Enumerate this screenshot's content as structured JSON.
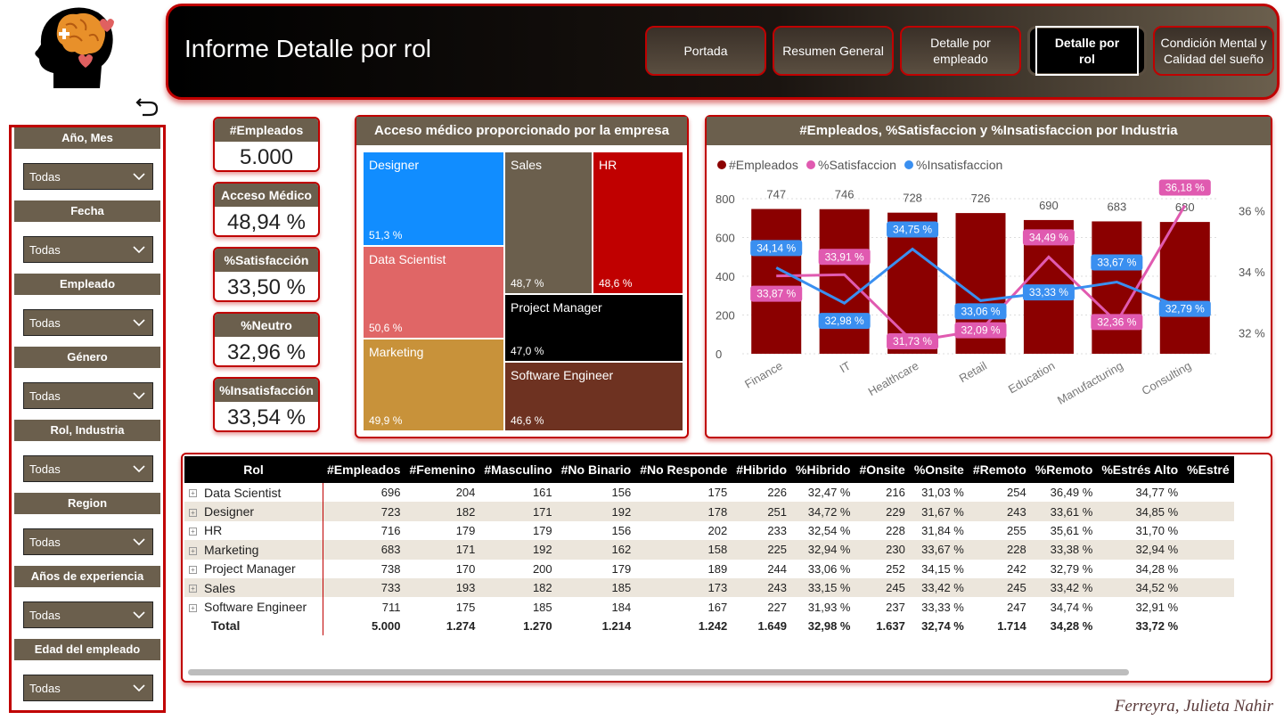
{
  "header": {
    "title": "Informe Detalle por rol",
    "nav": [
      {
        "label": "Portada",
        "active": false
      },
      {
        "label": "Resumen General",
        "active": false
      },
      {
        "label": "Detalle por empleado",
        "active": false
      },
      {
        "label": "Detalle por rol",
        "active": true
      },
      {
        "label": "Condición Mental y Calidad del sueño",
        "active": false
      }
    ]
  },
  "filters": [
    {
      "title": "Año, Mes",
      "value": "Todas"
    },
    {
      "title": "Fecha",
      "value": "Todas"
    },
    {
      "title": "Empleado",
      "value": "Todas"
    },
    {
      "title": "Género",
      "value": "Todas"
    },
    {
      "title": "Rol, Industria",
      "value": "Todas"
    },
    {
      "title": "Region",
      "value": "Todas"
    },
    {
      "title": "Años de experiencia",
      "value": "Todas"
    },
    {
      "title": "Edad del empleado",
      "value": "Todas"
    }
  ],
  "kpis": [
    {
      "title": "#Empleados",
      "value": "5.000"
    },
    {
      "title": "Acceso Médico",
      "value": "48,94 %"
    },
    {
      "title": "%Satisfacción",
      "value": "33,50 %"
    },
    {
      "title": "%Neutro",
      "value": "32,96 %"
    },
    {
      "title": "%Insatisfacción",
      "value": "33,54 %"
    }
  ],
  "colors": {
    "accent_red": "#c00000",
    "brown": "#6b5f4d",
    "bar": "#8b0000",
    "satisfaccion": "#e05ab0",
    "insatisfaccion": "#3a8ff0"
  },
  "chart_data": [
    {
      "type": "treemap",
      "title": "Acceso médico proporcionado por la empresa",
      "items": [
        {
          "label": "Designer",
          "value": "51,3 %",
          "color": "#118dff"
        },
        {
          "label": "Data Scientist",
          "value": "50,6 %",
          "color": "#e06666"
        },
        {
          "label": "Marketing",
          "value": "49,9 %",
          "color": "#c8923a"
        },
        {
          "label": "Sales",
          "value": "48,7 %",
          "color": "#6b5f4d"
        },
        {
          "label": "HR",
          "value": "48,6 %",
          "color": "#c00000"
        },
        {
          "label": "Project Manager",
          "value": "47,0 %",
          "color": "#000000"
        },
        {
          "label": "Software Engineer",
          "value": "46,6 %",
          "color": "#6e3221"
        }
      ]
    },
    {
      "type": "bar",
      "title": "#Empleados, %Satisfaccion y %Insatisfaccion por Industria",
      "categories": [
        "Finance",
        "IT",
        "Healthcare",
        "Retail",
        "Education",
        "Manufacturing",
        "Consulting"
      ],
      "series": [
        {
          "name": "#Empleados",
          "type": "bar",
          "axis": "left",
          "values": [
            747,
            746,
            728,
            726,
            690,
            683,
            680
          ],
          "labels": [
            "747",
            "746",
            "728",
            "726",
            "690",
            "683",
            "680"
          ]
        },
        {
          "name": "%Satisfaccion",
          "type": "line",
          "axis": "right",
          "values": [
            33.87,
            33.91,
            31.73,
            32.09,
            34.49,
            32.36,
            36.18
          ],
          "labels": [
            "33,87 %",
            "33,91 %",
            "31,73 %",
            "32,09 %",
            "34,49 %",
            "32,36 %",
            "36,18 %"
          ]
        },
        {
          "name": "%Insatisfaccion",
          "type": "line",
          "axis": "right",
          "values": [
            34.14,
            32.98,
            34.75,
            33.06,
            33.33,
            33.67,
            32.79
          ],
          "labels": [
            "34,14 %",
            "32,98 %",
            "34,75 %",
            "33,06 %",
            "33,33 %",
            "33,67 %",
            "32,79 %"
          ]
        }
      ],
      "ylim_left": [
        0,
        800
      ],
      "yticks_left": [
        "800",
        "600",
        "400",
        "200",
        "0"
      ],
      "ylim_right": [
        31,
        36.4
      ],
      "yticks_right": [
        {
          "v": 36,
          "label": "36 %"
        },
        {
          "v": 34,
          "label": "34 %"
        },
        {
          "v": 32,
          "label": "32 %"
        }
      ],
      "legend": "top-left",
      "grid": true
    }
  ],
  "table": {
    "headers": [
      "Rol",
      "#Empleados",
      "#Femenino",
      "#Masculino",
      "#No Binario",
      "#No Responde",
      "#Hibrido",
      "%Hibrido",
      "#Onsite",
      "%Onsite",
      "#Remoto",
      "%Remoto",
      "%Estrés Alto",
      "%Estré"
    ],
    "rows": [
      [
        "Data Scientist",
        "696",
        "204",
        "161",
        "156",
        "175",
        "226",
        "32,47 %",
        "216",
        "31,03 %",
        "254",
        "36,49 %",
        "34,77 %",
        ""
      ],
      [
        "Designer",
        "723",
        "182",
        "171",
        "192",
        "178",
        "251",
        "34,72 %",
        "229",
        "31,67 %",
        "243",
        "33,61 %",
        "34,85 %",
        ""
      ],
      [
        "HR",
        "716",
        "179",
        "179",
        "156",
        "202",
        "233",
        "32,54 %",
        "228",
        "31,84 %",
        "255",
        "35,61 %",
        "31,70 %",
        ""
      ],
      [
        "Marketing",
        "683",
        "171",
        "192",
        "162",
        "158",
        "225",
        "32,94 %",
        "230",
        "33,67 %",
        "228",
        "33,38 %",
        "32,94 %",
        ""
      ],
      [
        "Project Manager",
        "738",
        "170",
        "200",
        "179",
        "189",
        "244",
        "33,06 %",
        "252",
        "34,15 %",
        "242",
        "32,79 %",
        "34,28 %",
        ""
      ],
      [
        "Sales",
        "733",
        "193",
        "182",
        "185",
        "173",
        "243",
        "33,15 %",
        "245",
        "33,42 %",
        "245",
        "33,42 %",
        "34,52 %",
        ""
      ],
      [
        "Software Engineer",
        "711",
        "175",
        "185",
        "184",
        "167",
        "227",
        "31,93 %",
        "237",
        "33,33 %",
        "247",
        "34,74 %",
        "32,91 %",
        ""
      ]
    ],
    "total": [
      "Total",
      "5.000",
      "1.274",
      "1.270",
      "1.214",
      "1.242",
      "1.649",
      "32,98 %",
      "1.637",
      "32,74 %",
      "1.714",
      "34,28 %",
      "33,72 %",
      ""
    ]
  },
  "signature": "Ferreyra, Julieta Nahir"
}
